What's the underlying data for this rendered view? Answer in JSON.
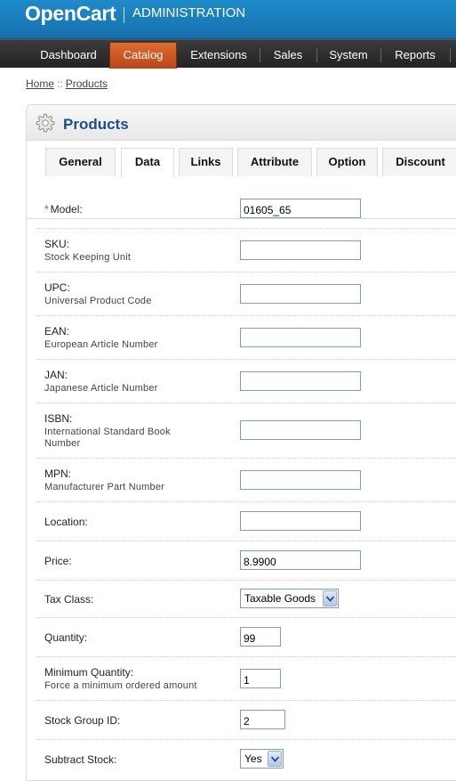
{
  "header": {
    "brand": "OpenCart",
    "subtitle": "ADMINISTRATION"
  },
  "menu": {
    "items": [
      {
        "label": "Dashboard"
      },
      {
        "label": "Catalog"
      },
      {
        "label": "Extensions"
      },
      {
        "label": "Sales"
      },
      {
        "label": "System"
      },
      {
        "label": "Reports"
      }
    ],
    "active": "Catalog"
  },
  "breadcrumb": {
    "home": "Home",
    "separator": "::",
    "current": "Products"
  },
  "box": {
    "title": "Products",
    "icon": "gear-icon"
  },
  "tabs": [
    {
      "label": "General"
    },
    {
      "label": "Data"
    },
    {
      "label": "Links"
    },
    {
      "label": "Attribute"
    },
    {
      "label": "Option"
    },
    {
      "label": "Discount"
    }
  ],
  "active_tab": "Data",
  "form": {
    "model": {
      "label": "Model:",
      "required": "*",
      "value": "01605_65"
    },
    "sku": {
      "label": "SKU:",
      "help": "Stock Keeping Unit",
      "value": ""
    },
    "upc": {
      "label": "UPC:",
      "help": "Universal Product Code",
      "value": ""
    },
    "ean": {
      "label": "EAN:",
      "help": "European Article Number",
      "value": ""
    },
    "jan": {
      "label": "JAN:",
      "help": "Japanese Article Number",
      "value": ""
    },
    "isbn": {
      "label": "ISBN:",
      "help_line1": "International Standard Book",
      "help_line2": "Number",
      "value": ""
    },
    "mpn": {
      "label": "MPN:",
      "help": "Manufacturer Part Number",
      "value": ""
    },
    "location": {
      "label": "Location:",
      "value": ""
    },
    "price": {
      "label": "Price:",
      "value": "8.9900"
    },
    "tax_class": {
      "label": "Tax Class:",
      "value": "Taxable Goods"
    },
    "quantity": {
      "label": "Quantity:",
      "value": "99"
    },
    "minimum": {
      "label": "Minimum Quantity:",
      "help": "Force a minimum ordered amount",
      "value": "1"
    },
    "stock_group": {
      "label": "Stock Group ID:",
      "value": "2"
    },
    "subtract": {
      "label": "Subtract Stock:",
      "value": "Yes"
    }
  }
}
